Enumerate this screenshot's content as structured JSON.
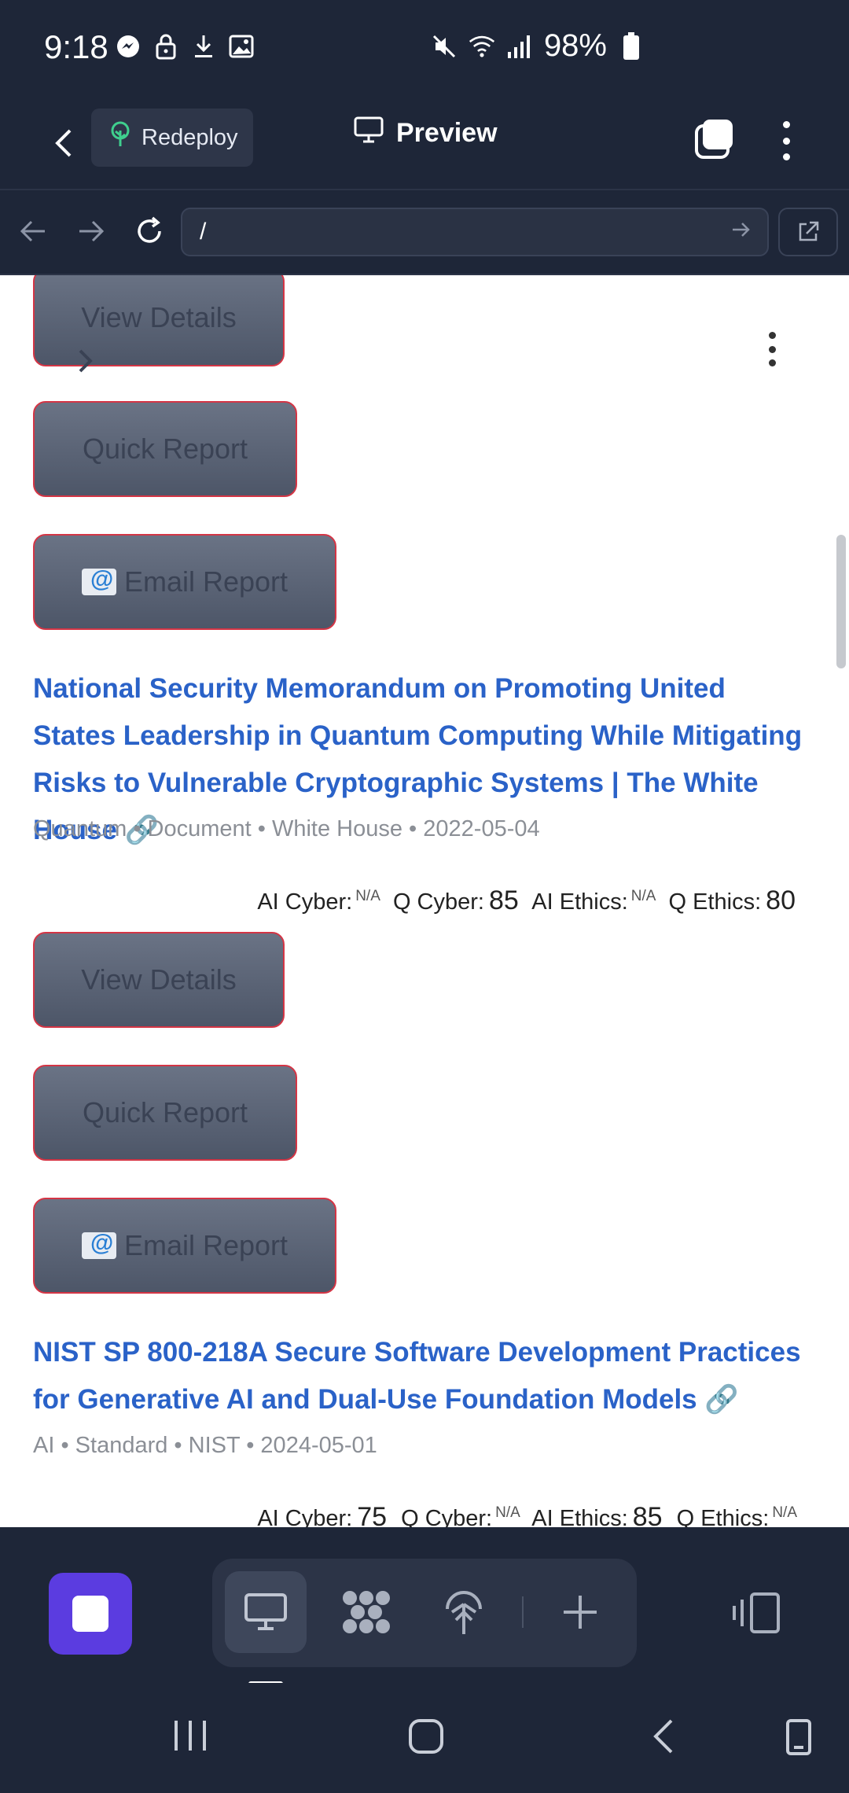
{
  "status_bar": {
    "time": "9:18",
    "battery": "98%"
  },
  "app_header": {
    "redeploy_label": "Redeploy",
    "preview_label": "Preview"
  },
  "browser": {
    "url": "/"
  },
  "content": {
    "prev_item_buttons": {
      "view": "View Details",
      "quick": "Quick Report",
      "email": "Email Report"
    },
    "items": [
      {
        "title": "National Security Memorandum on Promoting United States Leadership in Quantum Computing While Mitigating Risks to Vulnerable Cryptographic Systems | The White House 🔗",
        "meta": "Quantum • Document • White House • 2022-05-04",
        "scores": {
          "ai_cyber_label": "AI Cyber:",
          "ai_cyber": "N/A",
          "q_cyber_label": "Q Cyber:",
          "q_cyber": "85",
          "ai_ethics_label": "AI Ethics:",
          "ai_ethics": "N/A",
          "q_ethics_label": "Q Ethics:",
          "q_ethics": "80"
        },
        "buttons": {
          "view": "View Details",
          "quick": "Quick Report",
          "email": "Email Report"
        }
      },
      {
        "title": "NIST SP 800-218A Secure Software Development Practices for Generative AI and Dual-Use Foundation Models 🔗",
        "meta": "AI • Standard • NIST • 2024-05-01",
        "scores": {
          "ai_cyber_label": "AI Cyber:",
          "ai_cyber": "75",
          "q_cyber_label": "Q Cyber:",
          "q_cyber": "N/A",
          "ai_ethics_label": "AI Ethics:",
          "ai_ethics": "85",
          "q_ethics_label": "Q Ethics:",
          "q_ethics": "N/A"
        }
      }
    ]
  },
  "colors": {
    "chrome_bg": "#1e2638",
    "link": "#2a62c8",
    "button_border": "#d43545",
    "accent_purple": "#5b3ce0"
  }
}
